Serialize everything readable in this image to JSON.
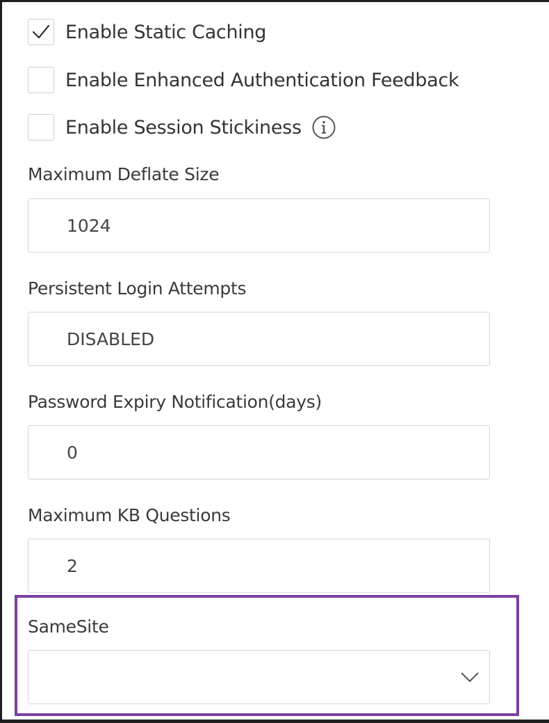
{
  "options": {
    "static_caching": {
      "label": "Enable Static Caching",
      "checked": true
    },
    "enhanced_auth_feedback": {
      "label": "Enable Enhanced Authentication Feedback",
      "checked": false
    },
    "session_stickiness": {
      "label": "Enable Session Stickiness",
      "checked": false,
      "icon": "info-icon"
    }
  },
  "fields": {
    "max_deflate_size": {
      "label": "Maximum Deflate Size",
      "value": "1024"
    },
    "persistent_login_attempts": {
      "label": "Persistent Login Attempts",
      "value": "DISABLED"
    },
    "password_expiry_notification": {
      "label": "Password Expiry Notification(days)",
      "value": "0"
    },
    "max_kb_questions": {
      "label": "Maximum KB Questions",
      "value": "2"
    }
  },
  "samesite": {
    "label": "SameSite",
    "value": "",
    "icon": "chevron-down-icon"
  },
  "colors": {
    "highlight": "#7b3fa1",
    "border": "#d6d6d6",
    "text": "#333333"
  }
}
